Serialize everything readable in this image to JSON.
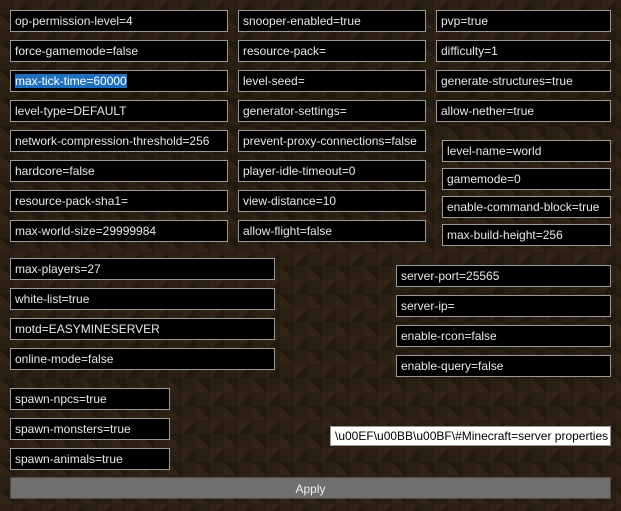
{
  "col1": {
    "op": "op-permission-level=4",
    "forcegm": "force-gamemode=false",
    "maxtick": "max-tick-time=60000",
    "ltype": "level-type=DEFAULT",
    "netcomp": "network-compression-threshold=256",
    "hardcore": "hardcore=false",
    "rpsha": "resource-pack-sha1=",
    "maxworld": "max-world-size=29999984"
  },
  "col2": {
    "snoop": "snooper-enabled=true",
    "rpack": "resource-pack=",
    "lseed": "level-seed=",
    "genset": "generator-settings=",
    "pproxy": "prevent-proxy-connections=false",
    "idleto": "player-idle-timeout=0",
    "viewd": "view-distance=10",
    "aflight": "allow-flight=false"
  },
  "col3a": {
    "pvp": "pvp=true",
    "diff": "difficulty=1",
    "genstr": "generate-structures=true",
    "anether": "allow-nether=true"
  },
  "col3b": {
    "lvlname": "level-name=world",
    "gmode": "gamemode=0",
    "ecb": "enable-command-block=true",
    "maxbh": "max-build-height=256"
  },
  "players": {
    "maxpl": "max-players=27",
    "wlist": "white-list=true",
    "motd": "motd=EASYMINESERVER",
    "online": "online-mode=false"
  },
  "net": {
    "sport": "server-port=25565",
    "sip": "server-ip=",
    "ercon": "enable-rcon=false",
    "equery": "enable-query=false"
  },
  "spawn": {
    "snpc": "spawn-npcs=true",
    "smon": "spawn-monsters=true",
    "sani": "spawn-animals=true"
  },
  "raw": {
    "value": "\\u00EF\\u00BB\\u00BF\\#Minecraft=server properties"
  },
  "buttons": {
    "apply": "Apply"
  }
}
